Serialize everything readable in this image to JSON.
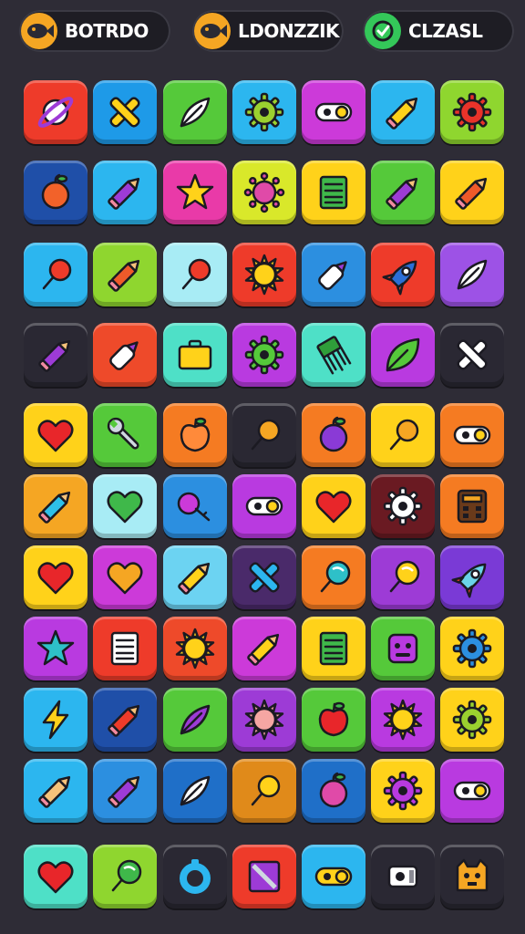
{
  "header": {
    "badges": [
      {
        "label": "BOTRDO",
        "icon": "fish-icon",
        "color": "#f5a623"
      },
      {
        "label": "LDONZZIK",
        "icon": "fish-icon",
        "color": "#f5a623"
      },
      {
        "label": "CLZASL",
        "icon": "check-icon",
        "color": "#34c759"
      }
    ]
  },
  "board": {
    "rows": [
      [
        {
          "icon": "planet-icon",
          "bg": "#ee3b2a",
          "fg": "#9d3bd6"
        },
        {
          "icon": "cross-icon",
          "bg": "#1e9ae8",
          "fg": "#ffd21a"
        },
        {
          "icon": "feather-icon",
          "bg": "#55c93a",
          "fg": "#ffffff"
        },
        {
          "icon": "gear-icon",
          "bg": "#2cb6ef",
          "fg": "#9bd12f"
        },
        {
          "icon": "toggle-icon",
          "bg": "#cc3ad9",
          "fg": "#ffffff"
        },
        {
          "icon": "pencil-icon",
          "bg": "#2cb6ef",
          "fg": "#ffd21a"
        },
        {
          "icon": "gear-icon",
          "bg": "#8fd62f",
          "fg": "#e8332a"
        }
      ],
      [
        {
          "icon": "fruit-icon",
          "bg": "#1f4fa8",
          "fg": "#f2622a"
        },
        {
          "icon": "pencil-icon",
          "bg": "#2cb6ef",
          "fg": "#9d3bd6"
        },
        {
          "icon": "star-icon",
          "bg": "#e93aa8",
          "fg": "#ffd21a"
        },
        {
          "icon": "virus-icon",
          "bg": "#d9e82a",
          "fg": "#e04aa8"
        },
        {
          "icon": "notepad-icon",
          "bg": "#ffd21a",
          "fg": "#3fb84a"
        },
        {
          "icon": "pencil-icon",
          "bg": "#55c93a",
          "fg": "#9d3bd6"
        },
        {
          "icon": "pencil-icon",
          "bg": "#ffd21a",
          "fg": "#ee5a2a"
        }
      ],
      [
        {
          "icon": "pin-icon",
          "bg": "#2cb6ef",
          "fg": "#ee3b2a"
        },
        {
          "icon": "pencil-icon",
          "bg": "#8fd62f",
          "fg": "#ee5a2a"
        },
        {
          "icon": "pin-icon",
          "bg": "#a8ecf5",
          "fg": "#ee3b2a"
        },
        {
          "icon": "sun-icon",
          "bg": "#ee3b2a",
          "fg": "#ffd21a"
        },
        {
          "icon": "marker-icon",
          "bg": "#2c8fe0",
          "fg": "#ffffff"
        },
        {
          "icon": "rocket-icon",
          "bg": "#ee3b2a",
          "fg": "#2c6fd6"
        },
        {
          "icon": "feather-icon",
          "bg": "#9d52e6",
          "fg": "#ffffff"
        }
      ],
      [
        {
          "icon": "pencil-icon",
          "bg": "#2a2833",
          "fg": "#9d3bd6"
        },
        {
          "icon": "marker-icon",
          "bg": "#ee4a2a",
          "fg": "#ffffff"
        },
        {
          "icon": "briefcase-icon",
          "bg": "#4ee0c7",
          "fg": "#ffd21a"
        },
        {
          "icon": "gear-icon",
          "bg": "#b93ae0",
          "fg": "#55c93a"
        },
        {
          "icon": "brush-icon",
          "bg": "#4ee0c7",
          "fg": "#2f9e3a"
        },
        {
          "icon": "leaf-icon",
          "bg": "#b93ae0",
          "fg": "#55c93a"
        },
        {
          "icon": "cross-icon",
          "bg": "#2a2833",
          "fg": "#ffffff"
        }
      ],
      [
        {
          "icon": "heart-icon",
          "bg": "#ffd21a",
          "fg": "#e8262a"
        },
        {
          "icon": "wrench-icon",
          "bg": "#55c93a",
          "fg": "#cfd8e0"
        },
        {
          "icon": "apple-icon",
          "bg": "#f57b22",
          "fg": "#ff8a3a"
        },
        {
          "icon": "pin-icon",
          "bg": "#2a2833",
          "fg": "#f5a623"
        },
        {
          "icon": "fruit-icon",
          "bg": "#f57b22",
          "fg": "#8a3ad6"
        },
        {
          "icon": "pin-icon",
          "bg": "#ffd21a",
          "fg": "#f5a623"
        },
        {
          "icon": "toggle-icon",
          "bg": "#f57b22",
          "fg": "#ffffff"
        }
      ],
      [
        {
          "icon": "pencil-icon",
          "bg": "#f5a623",
          "fg": "#2ec0e8"
        },
        {
          "icon": "heart-icon",
          "bg": "#a8ecf5",
          "fg": "#3fb84a"
        },
        {
          "icon": "key-icon",
          "bg": "#2c8fe0",
          "fg": "#cc3ad9"
        },
        {
          "icon": "toggle-icon",
          "bg": "#b93ae0",
          "fg": "#ffffff"
        },
        {
          "icon": "heart-icon",
          "bg": "#ffd21a",
          "fg": "#e8262a"
        },
        {
          "icon": "gear-icon",
          "bg": "#6a1a22",
          "fg": "#ffffff"
        },
        {
          "icon": "calculator-icon",
          "bg": "#f57b22",
          "fg": "#6a3a1a"
        }
      ],
      [
        {
          "icon": "heart-icon",
          "bg": "#ffd21a",
          "fg": "#e8262a"
        },
        {
          "icon": "heart-icon",
          "bg": "#cc3ad9",
          "fg": "#f5a623"
        },
        {
          "icon": "pencil-icon",
          "bg": "#6cd3f2",
          "fg": "#ffd21a"
        },
        {
          "icon": "cross-icon",
          "bg": "#4a2a6a",
          "fg": "#2cb6ef"
        },
        {
          "icon": "lollipop-icon",
          "bg": "#f57b22",
          "fg": "#2ec0c8"
        },
        {
          "icon": "lollipop-icon",
          "bg": "#9d3bd6",
          "fg": "#ffd21a"
        },
        {
          "icon": "rocket-icon",
          "bg": "#7a3ad6",
          "fg": "#6ad3e8"
        }
      ],
      [
        {
          "icon": "star-icon",
          "bg": "#b93ae0",
          "fg": "#2ec0c8"
        },
        {
          "icon": "notepad-icon",
          "bg": "#ee3b2a",
          "fg": "#ffffff"
        },
        {
          "icon": "sun-icon",
          "bg": "#ee4a2a",
          "fg": "#ffd21a"
        },
        {
          "icon": "pencil-icon",
          "bg": "#cc3ad9",
          "fg": "#ffd21a"
        },
        {
          "icon": "notepad-icon",
          "bg": "#ffd21a",
          "fg": "#3fb84a"
        },
        {
          "icon": "robot-icon",
          "bg": "#55c93a",
          "fg": "#b93ae0"
        },
        {
          "icon": "gear-icon",
          "bg": "#ffd21a",
          "fg": "#2c8fe0"
        }
      ],
      [
        {
          "icon": "lightning-icon",
          "bg": "#2cb6ef",
          "fg": "#ffd21a"
        },
        {
          "icon": "pencil-icon",
          "bg": "#1f4fa8",
          "fg": "#ee3b2a"
        },
        {
          "icon": "feather-icon",
          "bg": "#55c93a",
          "fg": "#9d3bd6"
        },
        {
          "icon": "sun-icon",
          "bg": "#9d3bd6",
          "fg": "#f5a6a3"
        },
        {
          "icon": "apple-icon",
          "bg": "#55c93a",
          "fg": "#e8262a"
        },
        {
          "icon": "sun-icon",
          "bg": "#b93ae0",
          "fg": "#ffd21a"
        },
        {
          "icon": "gear-icon",
          "bg": "#ffd21a",
          "fg": "#9bd12f"
        }
      ],
      [
        {
          "icon": "pencil-icon",
          "bg": "#2cb6ef",
          "fg": "#f5c27a"
        },
        {
          "icon": "pencil-icon",
          "bg": "#2c8fe0",
          "fg": "#9d3bd6"
        },
        {
          "icon": "feather-icon",
          "bg": "#1f6fc8",
          "fg": "#ffffff"
        },
        {
          "icon": "pin-icon",
          "bg": "#e08a1a",
          "fg": "#ffd21a"
        },
        {
          "icon": "fruit-icon",
          "bg": "#1f6fc8",
          "fg": "#e04aa8"
        },
        {
          "icon": "gear-icon",
          "bg": "#ffd21a",
          "fg": "#b93ae0"
        },
        {
          "icon": "toggle-icon",
          "bg": "#b93ae0",
          "fg": "#ffffff"
        }
      ],
      [
        {
          "icon": "heart-icon",
          "bg": "#4ee0c7",
          "fg": "#e8262a"
        },
        {
          "icon": "lollipop-icon",
          "bg": "#8fd62f",
          "fg": "#3fb84a"
        },
        {
          "icon": "ring-icon",
          "bg": "#2a2833",
          "fg": "#2cb6ef"
        },
        {
          "icon": "frame-icon",
          "bg": "#ee3b2a",
          "fg": "#9d3bd6"
        },
        {
          "icon": "toggle-icon",
          "bg": "#2cb6ef",
          "fg": "#ffd21a"
        },
        {
          "icon": "sharpener-icon",
          "bg": "#2a2833",
          "fg": "#ffffff"
        },
        {
          "icon": "monster-icon",
          "bg": "#2a2833",
          "fg": "#f5a623"
        }
      ]
    ]
  }
}
